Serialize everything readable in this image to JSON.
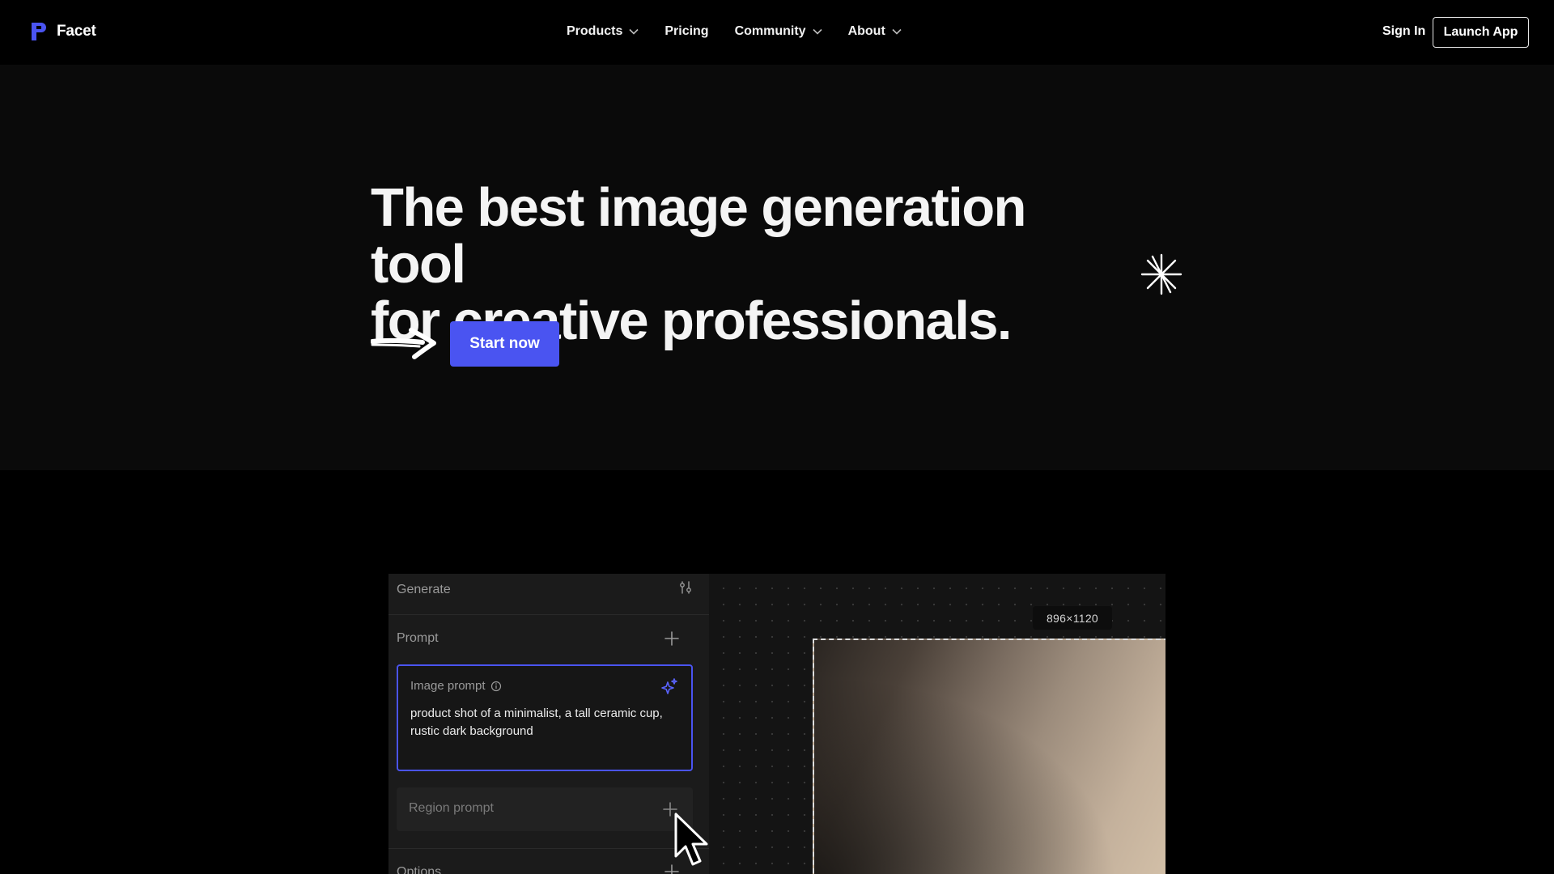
{
  "nav": {
    "brand": "Facet",
    "links": [
      "Products",
      "Pricing",
      "Community",
      "About"
    ],
    "sign_in": "Sign In",
    "launch_app": "Launch App"
  },
  "hero": {
    "title_line1": "The best image generation tool",
    "title_line2": "for creative professionals.",
    "cta": "Start now",
    "accent_color": "#4a54f1"
  },
  "app_preview": {
    "panel_title": "Generate",
    "prompt_section": "Prompt",
    "image_prompt_label": "Image prompt",
    "image_prompt_text": "product shot of a minimalist, a tall ceramic cup, rustic dark background",
    "region_prompt_label": "Region prompt",
    "options_label": "Options",
    "canvas_size": "896×1120"
  }
}
